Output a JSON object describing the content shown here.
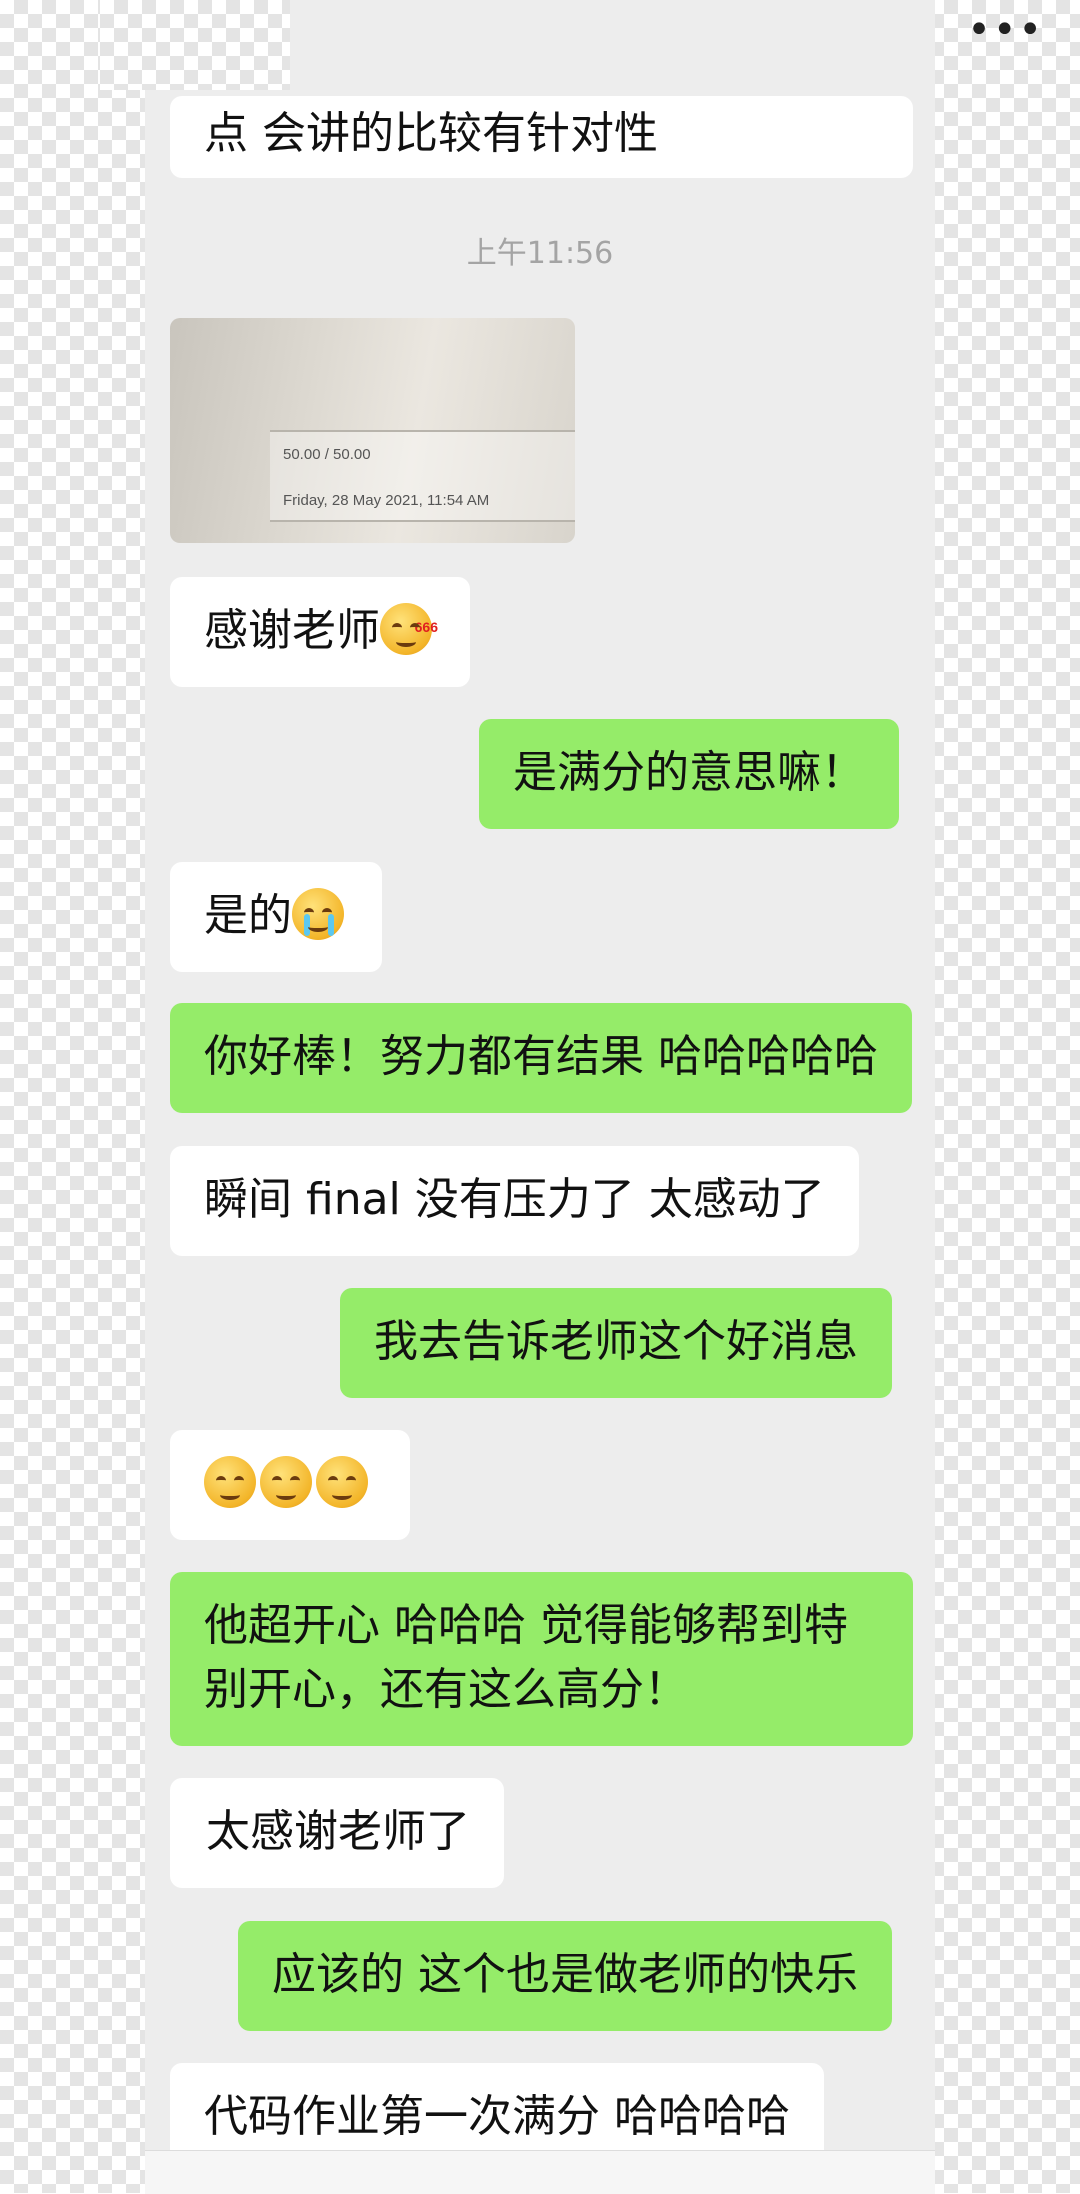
{
  "header": {
    "more_label": "•••"
  },
  "timestamp": "上午11:56",
  "image_message": {
    "score": "50.00 / 50.00",
    "date": "Friday, 28 May 2021, 11:54 AM"
  },
  "messages": [
    {
      "side": "in",
      "text": "点 会讲的比较有针对性"
    },
    {
      "side": "in",
      "text": "感谢老师",
      "emoji": "smirk-666-emoji"
    },
    {
      "side": "out",
      "text": "是满分的意思嘛！"
    },
    {
      "side": "in",
      "text": "是的",
      "emoji": "crying-emoji"
    },
    {
      "side": "out",
      "text": "你好棒！努力都有结果 哈哈哈哈哈"
    },
    {
      "side": "in",
      "text": "瞬间 final 没有压力了 太感动了"
    },
    {
      "side": "out",
      "text": "我去告诉老师这个好消息"
    },
    {
      "side": "in",
      "text": "",
      "emoji": "smirk-emoji x3"
    },
    {
      "side": "out",
      "text": "他超开心 哈哈哈 觉得能够帮到特",
      "text2": "别开心，还有这么高分！"
    },
    {
      "side": "in",
      "text": "太感谢老师了"
    },
    {
      "side": "out",
      "text": "应该的 这个也是做老师的快乐"
    },
    {
      "side": "in",
      "text": "代码作业第一次满分 哈哈哈哈"
    }
  ],
  "colors": {
    "incoming": "#ffffff",
    "outgoing": "#95ec69",
    "chat_bg": "#ededed"
  }
}
